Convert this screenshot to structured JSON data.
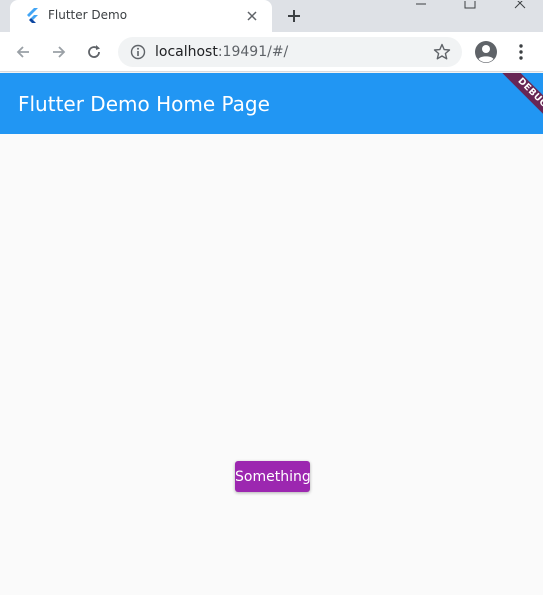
{
  "browser": {
    "tab": {
      "title": "Flutter Demo",
      "favicon_icon": "flutter-logo-icon",
      "close_icon": "close-icon"
    },
    "new_tab_icon": "plus-icon",
    "window_controls": [
      "minimize-icon",
      "maximize-icon",
      "close-icon"
    ],
    "nav": {
      "back_icon": "arrow-left-icon",
      "forward_icon": "arrow-right-icon",
      "reload_icon": "reload-icon"
    },
    "omnibox": {
      "host": "localhost",
      "rest": ":19491/#/",
      "info_icon": "info-icon",
      "star_icon": "star-icon"
    },
    "profile_icon": "account-circle-icon",
    "menu_icon": "more-vert-icon"
  },
  "app": {
    "title": "Flutter Demo Home Page",
    "debug_banner": "DEBUG",
    "button_label": "Something"
  },
  "colors": {
    "appbar": "#2196f3",
    "button": "#9c27b0",
    "background": "#fafafa",
    "debug_banner": "#800020"
  }
}
